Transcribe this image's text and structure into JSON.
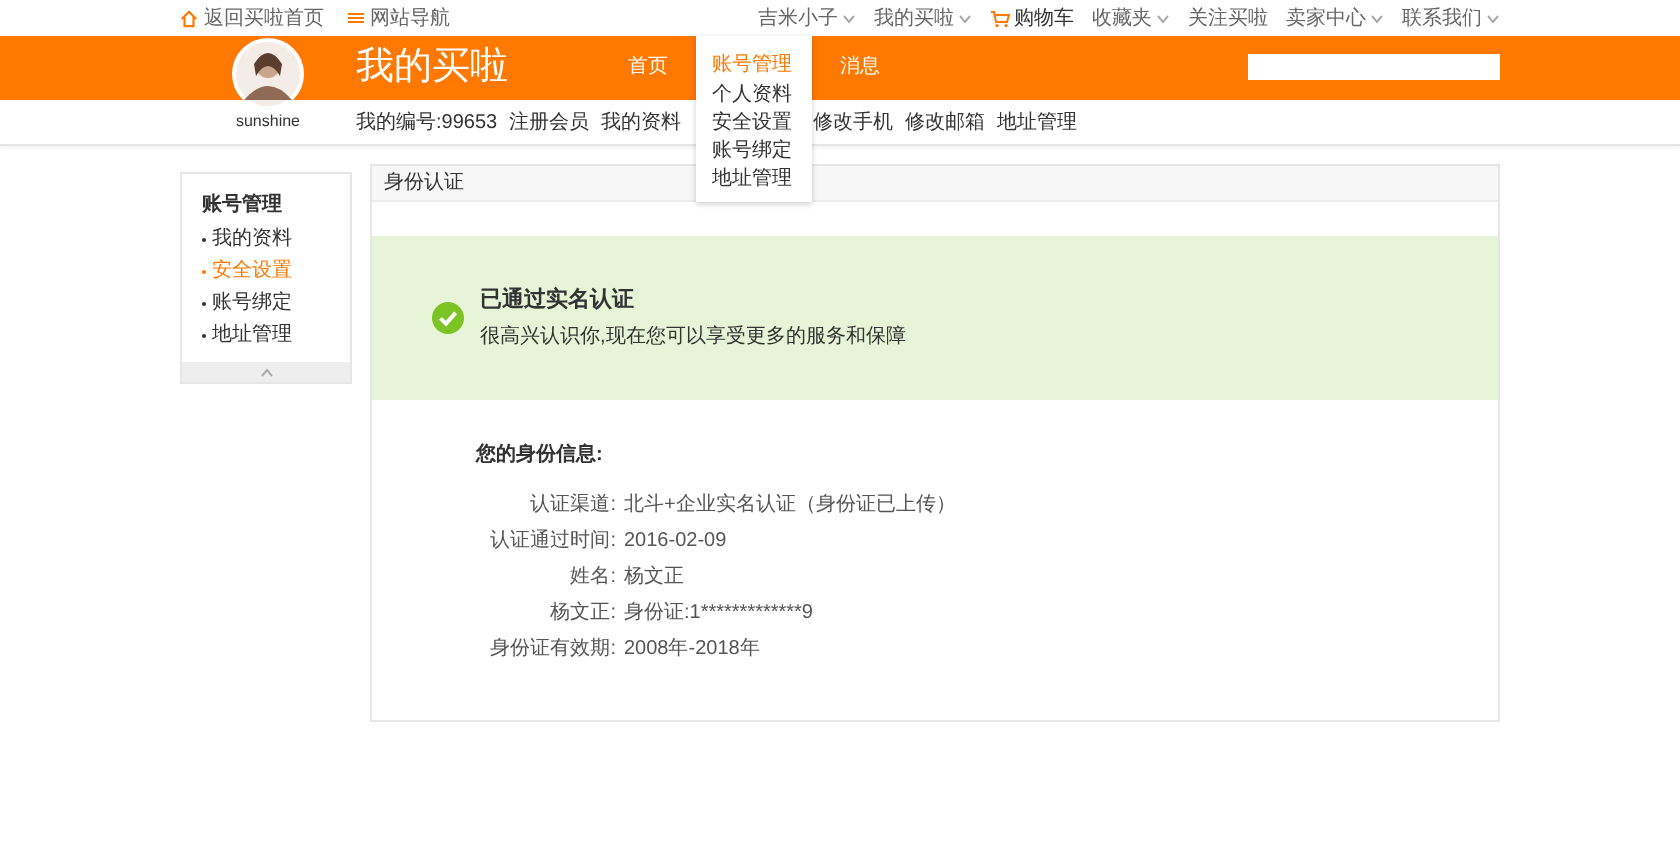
{
  "top_bar": {
    "left_links": [
      {
        "label": "返回买啦首页"
      },
      {
        "label": "网站导航"
      }
    ],
    "right_links": [
      {
        "label": "吉米小子",
        "kind": "menu"
      },
      {
        "label": "我的买啦",
        "kind": "menu"
      },
      {
        "label": "购物车",
        "kind": "cart"
      },
      {
        "label": "收藏夹",
        "kind": "menu"
      },
      {
        "label": "关注买啦",
        "kind": "plain"
      },
      {
        "label": "卖家中心",
        "kind": "menu"
      },
      {
        "label": "联系我们",
        "kind": "menu"
      }
    ]
  },
  "header": {
    "logo": "我的买啦",
    "username": "sunshine",
    "nav": [
      {
        "label": "首页",
        "selected": false
      },
      {
        "label": "账号管理",
        "selected": true,
        "menu": [
          "个人资料",
          "安全设置",
          "账号绑定",
          "地址管理"
        ]
      },
      {
        "label": "消息",
        "selected": false
      }
    ]
  },
  "subnav": {
    "items": [
      "我的编号:99653",
      "注册会员",
      "我的资料",
      "修改手机",
      "修改邮箱",
      "地址管理"
    ]
  },
  "sidebar": {
    "title": "账号管理",
    "items": [
      {
        "label": "我的资料",
        "selected": false
      },
      {
        "label": "安全设置",
        "selected": true
      },
      {
        "label": "账号绑定",
        "selected": false
      },
      {
        "label": "地址管理",
        "selected": false
      }
    ]
  },
  "panel": {
    "title": "身份认证",
    "status": {
      "title": "已通过实名认证",
      "message": "很高兴认识你,现在您可以享受更多的服务和保障"
    },
    "info": {
      "title": "您的身份信息:",
      "rows": [
        {
          "label": "认证渠道:",
          "value": "北斗+企业实名认证（身份证已上传）"
        },
        {
          "label": "认证通过时间:",
          "value": "2016-02-09"
        },
        {
          "label": "姓名:",
          "value": "杨文正"
        },
        {
          "label": "杨文正:",
          "value": "身份证:1*************9"
        },
        {
          "label": "身份证有效期:",
          "value": "2008年-2018年"
        }
      ]
    }
  }
}
